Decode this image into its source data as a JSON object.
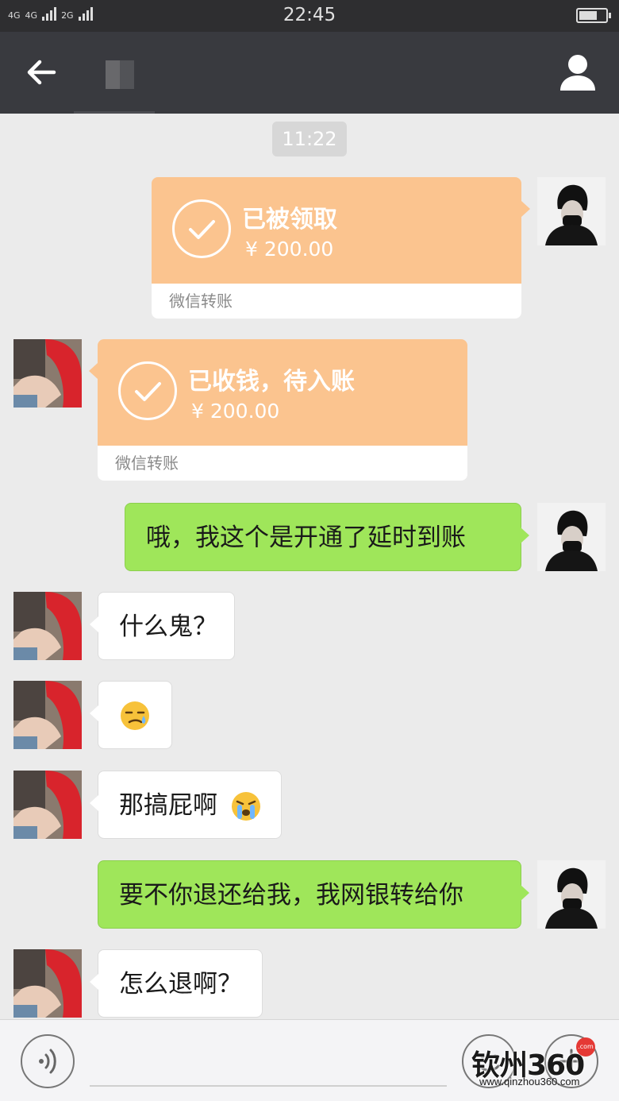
{
  "status_bar": {
    "signal_1": "4G",
    "signal_2": "4G",
    "signal_3": "2G",
    "time": "22:45",
    "battery_level": 0.7
  },
  "nav": {
    "back_icon": "arrow-left-icon",
    "profile_icon": "person-icon"
  },
  "chat": {
    "timestamp": "11:22",
    "messages": [
      {
        "from": "self",
        "type": "transfer",
        "title": "已被领取",
        "amount": "¥ 200.00",
        "footer": "微信转账"
      },
      {
        "from": "other",
        "type": "transfer",
        "title": "已收钱，待入账",
        "amount": "¥ 200.00",
        "footer": "微信转账"
      },
      {
        "from": "self",
        "type": "text",
        "text": "哦，我这个是开通了延时到账"
      },
      {
        "from": "other",
        "type": "text",
        "text": "什么鬼？"
      },
      {
        "from": "other",
        "type": "emoji",
        "emoji": "smirk-sweat-emoji"
      },
      {
        "from": "other",
        "type": "text",
        "text": "那搞屁啊",
        "emoji": "crying-emoji"
      },
      {
        "from": "self",
        "type": "text",
        "text": "要不你退还给我，我网银转给你"
      },
      {
        "from": "other",
        "type": "text",
        "text": "怎么退啊？"
      }
    ]
  },
  "input_bar": {
    "voice_icon": "voice-icon",
    "emoji_icon": "smiley-icon",
    "plus_icon": "plus-icon"
  },
  "watermark": {
    "main": "钦州360",
    "sub": "www.qinzhou360.com",
    "badge": ".com"
  },
  "colors": {
    "nav_bg": "#393a3f",
    "chat_bg": "#ebebeb",
    "green_bubble": "#9fe65a",
    "transfer_orange": "#fbc48f"
  }
}
